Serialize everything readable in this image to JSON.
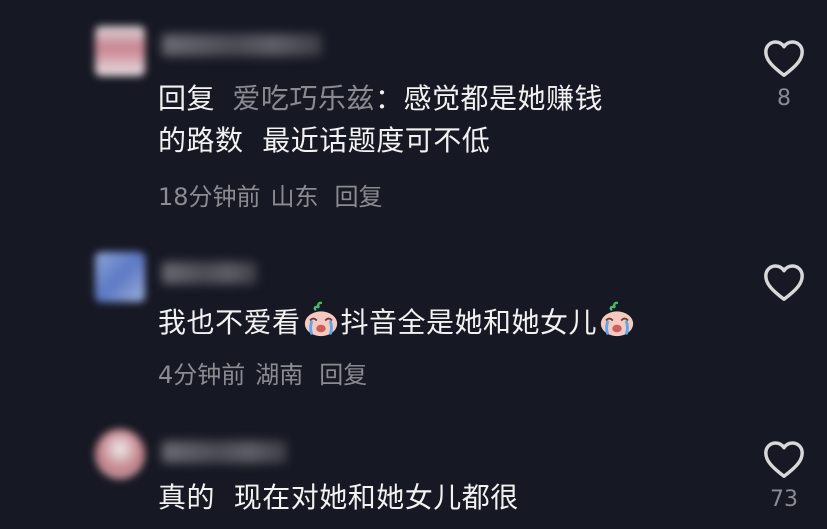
{
  "comments": [
    {
      "reply_prefix": "回复",
      "reply_target": "爱吃巧乐兹",
      "text_line1": "：感觉都是她赚钱",
      "text_line2": "的路数  最近话题度可不低",
      "time": "18分钟前",
      "location": "山东",
      "reply_label": "回复",
      "likes": "8"
    },
    {
      "text_part1": "我也不爱看",
      "text_part2": "抖音全是她和她女儿",
      "emoji": "crying-face-emoji",
      "time": "4分钟前",
      "location": "湖南",
      "reply_label": "回复",
      "likes": ""
    },
    {
      "text_line1": "真的  现在对她和她女儿都很",
      "likes": "73"
    }
  ],
  "colors": {
    "background": "#161823",
    "text": "#f2f2f2",
    "muted": "#8b8c92"
  },
  "icons": {
    "like": "heart-outline-icon"
  }
}
